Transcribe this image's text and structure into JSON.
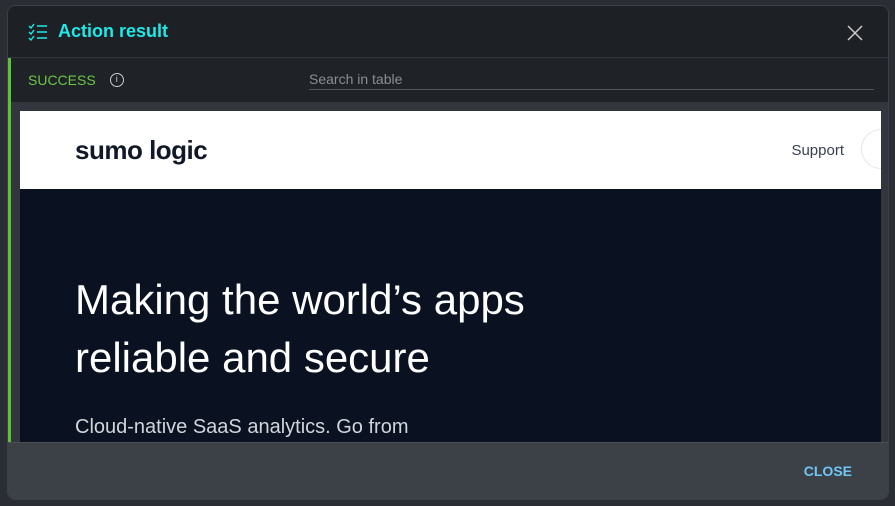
{
  "dialog": {
    "title": "Action result",
    "icon": "checklist-icon",
    "accent": "#1de9e6"
  },
  "toolbar": {
    "status": "SUCCESS",
    "status_color": "#6cc644",
    "search_placeholder": "Search in table"
  },
  "screenshot": {
    "logo": "sumo logic",
    "nav_link": "Support",
    "headline_line1": "Making the world’s apps",
    "headline_line2": "reliable and secure",
    "subtext": "Cloud-native SaaS analytics. Go from"
  },
  "footer": {
    "close_label": "CLOSE"
  }
}
